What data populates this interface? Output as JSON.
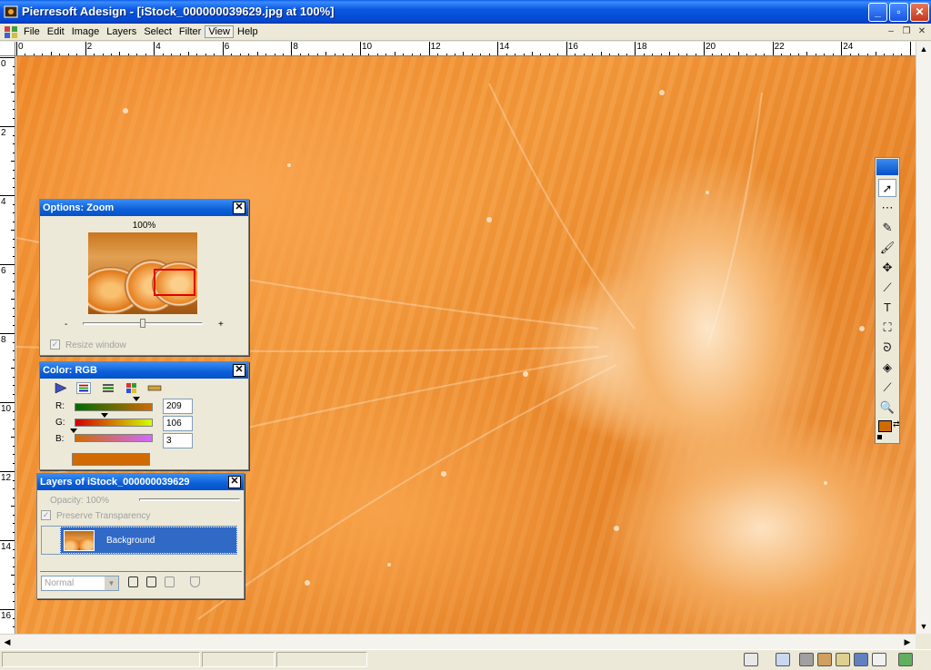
{
  "window": {
    "title": "Pierresoft Adesign - [iStock_000000039629.jpg at 100%]",
    "buttons": {
      "minimize": "_",
      "maximize": "▫",
      "close": "✕"
    }
  },
  "menu": {
    "items": [
      "File",
      "Edit",
      "Image",
      "Layers",
      "Select",
      "Filter",
      "View",
      "Help"
    ],
    "mdi_buttons": {
      "minimize": "–",
      "restore": "❐",
      "close": "✕"
    }
  },
  "rulers": {
    "horizontal_labels": [
      "0",
      "2",
      "4",
      "6",
      "8",
      "10",
      "12",
      "14",
      "16",
      "18",
      "20",
      "22",
      "24"
    ],
    "vertical_labels": [
      "0",
      "2",
      "4",
      "6",
      "8",
      "10",
      "12",
      "14",
      "16"
    ]
  },
  "zoom_panel": {
    "title": "Options: Zoom",
    "percent": "100%",
    "minus": "-",
    "plus": "+",
    "slider_fraction": 0.5,
    "resize_label": "Resize window",
    "resize_checked": true
  },
  "color_panel": {
    "title": "Color: RGB",
    "channels": [
      {
        "label": "R:",
        "value": "209"
      },
      {
        "label": "G:",
        "value": "106"
      },
      {
        "label": "B:",
        "value": "3"
      }
    ],
    "swatch_color": "#d16a03"
  },
  "layers_panel": {
    "title": "Layers of iStock_000000039629",
    "opacity_label": "Opacity: 100%",
    "preserve_label": "Preserve Transparency",
    "layer_name": "Background",
    "blend_mode": "Normal"
  },
  "colors": {
    "title_blue": "#0a5fd8",
    "selection_blue": "#3169c6",
    "foreground_color": "#d16a03"
  },
  "tools": [
    "move-tool",
    "marquee-tool",
    "pencil-tool",
    "brush-tool",
    "clone-tool",
    "line-tool",
    "text-tool",
    "transform-tool",
    "lasso-tool",
    "fill-tool",
    "eyedropper-tool",
    "zoom-tool"
  ]
}
